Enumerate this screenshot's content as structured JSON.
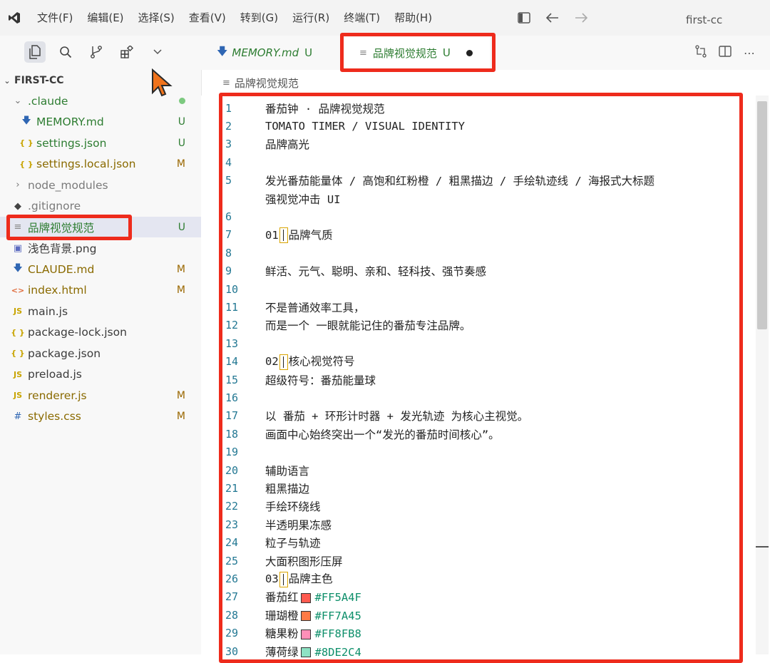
{
  "titlebar": {
    "menus": [
      "文件(F)",
      "编辑(E)",
      "选择(S)",
      "查看(V)",
      "转到(G)",
      "运行(R)",
      "终端(T)",
      "帮助(H)"
    ],
    "window_title": "first-cc"
  },
  "explorer": {
    "section_title": "FIRST-CC",
    "items": [
      {
        "name": ".claude",
        "type": "folder-open",
        "badge": "",
        "dot": true
      },
      {
        "name": "MEMORY.md",
        "type": "md",
        "badge": "U"
      },
      {
        "name": "settings.json",
        "type": "json",
        "badge": "U"
      },
      {
        "name": "settings.local.json",
        "type": "json",
        "badge": "M"
      },
      {
        "name": "node_modules",
        "type": "folder-closed",
        "badge": ""
      },
      {
        "name": ".gitignore",
        "type": "git",
        "badge": ""
      },
      {
        "name": "品牌视觉规范",
        "type": "text",
        "badge": "U"
      },
      {
        "name": "浅色背景.png",
        "type": "image",
        "badge": ""
      },
      {
        "name": "CLAUDE.md",
        "type": "md",
        "badge": "M"
      },
      {
        "name": "index.html",
        "type": "html",
        "badge": "M"
      },
      {
        "name": "main.js",
        "type": "js",
        "badge": ""
      },
      {
        "name": "package-lock.json",
        "type": "json",
        "badge": ""
      },
      {
        "name": "package.json",
        "type": "json",
        "badge": ""
      },
      {
        "name": "preload.js",
        "type": "js",
        "badge": ""
      },
      {
        "name": "renderer.js",
        "type": "js",
        "badge": "M"
      },
      {
        "name": "styles.css",
        "type": "css",
        "badge": "M"
      }
    ]
  },
  "tabs": [
    {
      "label": "MEMORY.md",
      "badge": "U"
    },
    {
      "label": "品牌视觉规范",
      "badge": "U"
    }
  ],
  "breadcrumb": "品牌视觉规范",
  "editor": {
    "lines": [
      {
        "n": "1",
        "text": "番茄钟 · 品牌视觉规范"
      },
      {
        "n": "2",
        "text": "TOMATO TIMER / VISUAL IDENTITY"
      },
      {
        "n": "3",
        "text": "品牌高光"
      },
      {
        "n": "4",
        "text": ""
      },
      {
        "n": "5",
        "text": "发光番茄能量体 / 高饱和红粉橙 / 粗黑描边 / 手绘轨迹线 / 海报式大标题"
      },
      {
        "n": "",
        "text": "强视觉冲击 UI"
      },
      {
        "n": "6",
        "text": ""
      },
      {
        "n": "7",
        "text": "01",
        "after": "品牌气质",
        "cursor": true
      },
      {
        "n": "8",
        "text": ""
      },
      {
        "n": "9",
        "text": "鲜活、元气、聪明、亲和、轻科技、强节奏感"
      },
      {
        "n": "10",
        "text": ""
      },
      {
        "n": "11",
        "text": "不是普通效率工具，"
      },
      {
        "n": "12",
        "text": "而是一个 一眼就能记住的番茄专注品牌。"
      },
      {
        "n": "13",
        "text": ""
      },
      {
        "n": "14",
        "text": "02",
        "after": "核心视觉符号",
        "cursor": true
      },
      {
        "n": "15",
        "text": "超级符号：番茄能量球"
      },
      {
        "n": "16",
        "text": ""
      },
      {
        "n": "17",
        "text": "以 番茄 + 环形计时器 + 发光轨迹 为核心主视觉。"
      },
      {
        "n": "18",
        "text": "画面中心始终突出一个“发光的番茄时间核心”。"
      },
      {
        "n": "19",
        "text": ""
      },
      {
        "n": "20",
        "text": "辅助语言"
      },
      {
        "n": "21",
        "text": "粗黑描边"
      },
      {
        "n": "22",
        "text": "手绘环绕线"
      },
      {
        "n": "23",
        "text": "半透明果冻感"
      },
      {
        "n": "24",
        "text": "粒子与轨迹"
      },
      {
        "n": "25",
        "text": "大面积图形压屏"
      },
      {
        "n": "26",
        "text": "03",
        "after": "品牌主色",
        "cursor": true
      },
      {
        "n": "27",
        "text": "番茄红",
        "swatch": "#FF5A4F",
        "hex": "#FF5A4F"
      },
      {
        "n": "28",
        "text": "珊瑚橙",
        "swatch": "#FF7A45",
        "hex": "#FF7A45"
      },
      {
        "n": "29",
        "text": "糖果粉",
        "swatch": "#FF8FB8",
        "hex": "#FF8FB8"
      },
      {
        "n": "30",
        "text": "薄荷绿",
        "swatch": "#8DE2C4",
        "hex": "#8DE2C4"
      }
    ]
  },
  "colors": {
    "annotation": "#ee2b1c",
    "git_untracked": "#2e7d32",
    "git_modified": "#9a6700",
    "line_number": "#237893"
  }
}
